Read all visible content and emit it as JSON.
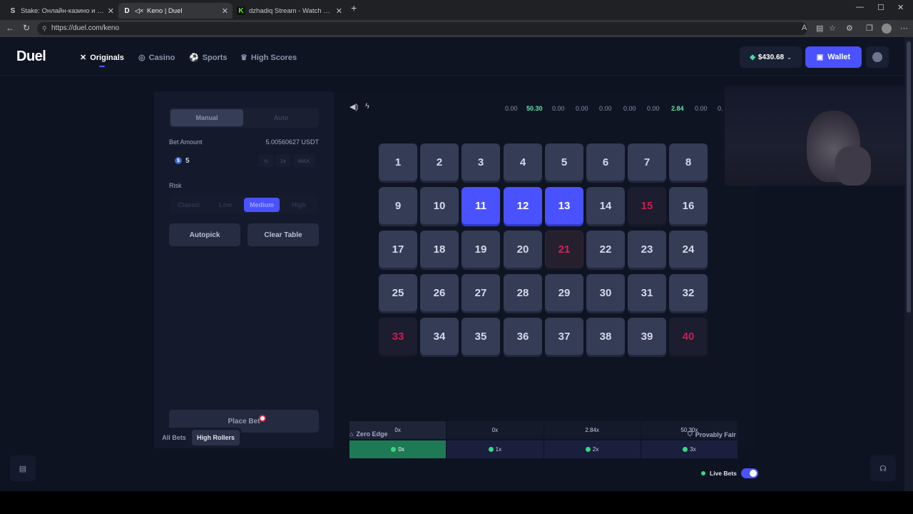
{
  "browser": {
    "tabs": [
      {
        "favicon": "S",
        "title": "Stake: Онлайн-казино и ставки на",
        "active": false
      },
      {
        "favicon": "D",
        "title": "Keno | Duel",
        "active": true
      },
      {
        "favicon": "K",
        "title": "dzhadiq Stream - Watch Live on K",
        "active": false
      }
    ],
    "new_tab": "+",
    "url": "https://duel.com/keno",
    "window_controls": [
      "—",
      "☐",
      "✕"
    ]
  },
  "site": {
    "logo": "Duel",
    "nav": [
      {
        "label": "Originals",
        "icon": "originals-icon",
        "active": true
      },
      {
        "label": "Casino",
        "icon": "casino-icon",
        "active": false
      },
      {
        "label": "Sports",
        "icon": "sports-icon",
        "active": false
      },
      {
        "label": "High Scores",
        "icon": "trophy-icon",
        "active": false
      }
    ],
    "balance": "$430.68",
    "wallet_label": "Wallet"
  },
  "controls": {
    "mode_manual": "Manual",
    "mode_auto": "Auto",
    "bet_amount_label": "Bet Amount",
    "bet_amount_usdt": "5.00560627 USDT",
    "bet_value": "5",
    "coin_symbol": "$",
    "half": "½",
    "double": "2x",
    "max": "MAX",
    "risk_label": "Risk",
    "risk_options": [
      "Classic",
      "Low",
      "Medium",
      "High"
    ],
    "risk_selected": "Medium",
    "autopick": "Autopick",
    "clear_table": "Clear Table",
    "place_bet": "Place Bet"
  },
  "history": [
    {
      "value": "0.00",
      "hit": false
    },
    {
      "value": "50.30",
      "hit": true
    },
    {
      "value": "0.00",
      "hit": false
    },
    {
      "value": "0.00",
      "hit": false
    },
    {
      "value": "0.00",
      "hit": false
    },
    {
      "value": "0.00",
      "hit": false
    },
    {
      "value": "0.00",
      "hit": false
    },
    {
      "value": "2.84",
      "hit": true
    },
    {
      "value": "0.00",
      "hit": false
    },
    {
      "value": "0.",
      "hit": false
    }
  ],
  "board": {
    "selected": [
      11,
      12,
      13
    ],
    "misses": [
      15,
      21,
      33,
      40
    ]
  },
  "payouts": {
    "multipliers": [
      "0x",
      "0x",
      "2.84x",
      "50.30x"
    ],
    "hits": [
      "0x",
      "1x",
      "2x",
      "3x"
    ]
  },
  "footer": {
    "zero_edge": "Zero Edge",
    "provably_fair": "Provably Fair",
    "tab_all": "All Bets",
    "tab_high": "High Rollers",
    "live_bets": "Live Bets"
  }
}
